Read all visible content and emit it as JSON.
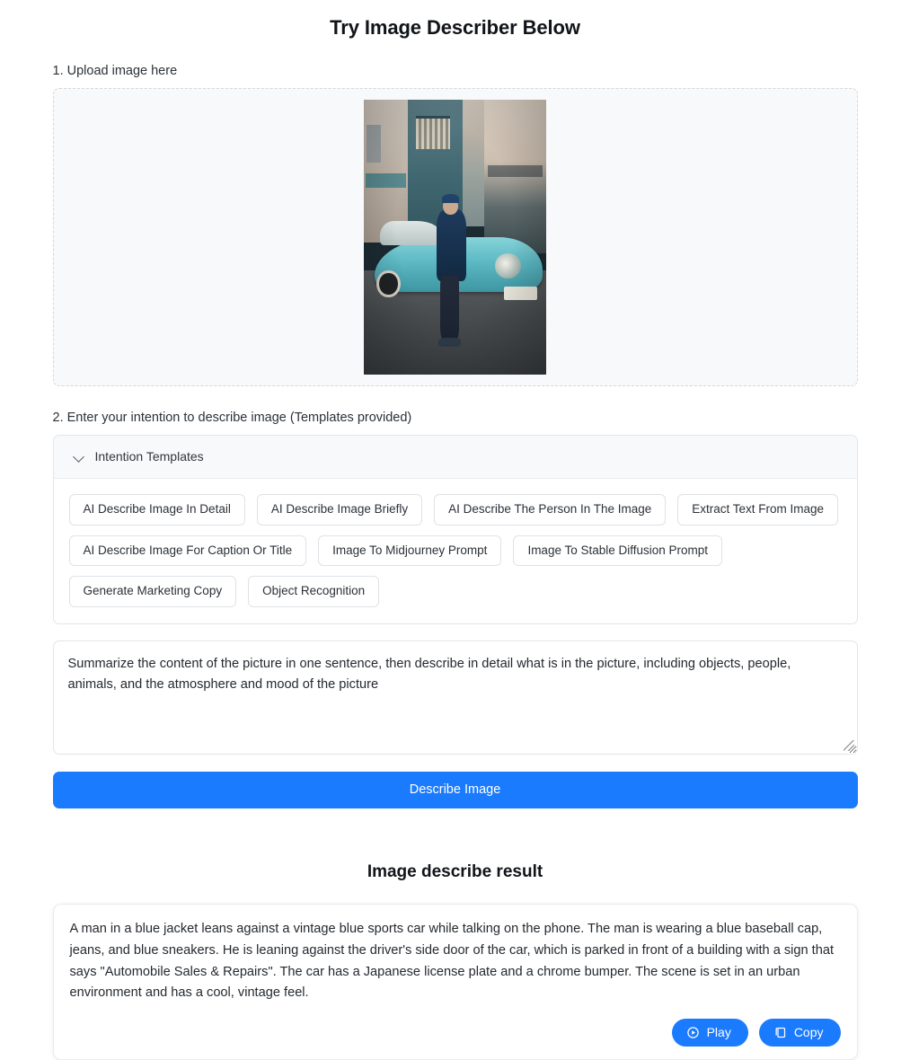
{
  "header": {
    "title": "Try Image Describer Below"
  },
  "upload": {
    "step_label": "1. Upload image here",
    "image_alt": "Man in blue jacket leaning against a vintage teal sports car on a city street"
  },
  "intention": {
    "step_label": "2. Enter your intention to describe image (Templates provided)",
    "panel_title": "Intention Templates",
    "chevron_icon": "chevron-down-icon",
    "templates": [
      {
        "label": "AI Describe Image In Detail"
      },
      {
        "label": "AI Describe Image Briefly"
      },
      {
        "label": "AI Describe The Person In The Image"
      },
      {
        "label": "Extract Text From Image"
      },
      {
        "label": "AI Describe Image For Caption Or Title"
      },
      {
        "label": "Image To Midjourney Prompt"
      },
      {
        "label": "Image To Stable Diffusion Prompt"
      },
      {
        "label": "Generate Marketing Copy"
      },
      {
        "label": "Object Recognition"
      }
    ],
    "prompt_value": "Summarize the content of the picture in one sentence, then describe in detail what is in the picture, including objects, people, animals, and the atmosphere and mood of the picture",
    "prompt_placeholder": "Enter your intention to describe image"
  },
  "submit": {
    "label": "Describe Image"
  },
  "result": {
    "title": "Image describe result",
    "text": "A man in a blue jacket leans against a vintage blue sports car while talking on the phone. The man is wearing a blue baseball cap, jeans, and blue sneakers. He is leaning against the driver's side door of the car, which is parked in front of a building with a sign that says \"Automobile Sales & Repairs\". The car has a Japanese license plate and a chrome bumper. The scene is set in an urban environment and has a cool, vintage feel.",
    "play_label": "Play",
    "play_icon": "play-circle-icon",
    "copy_label": "Copy",
    "copy_icon": "copy-icon"
  },
  "colors": {
    "accent": "#1a7bff",
    "page_background": "#ffffff",
    "panel_background": "#f8f9fa",
    "border": "#e3e5e8",
    "text": "#24292f"
  }
}
